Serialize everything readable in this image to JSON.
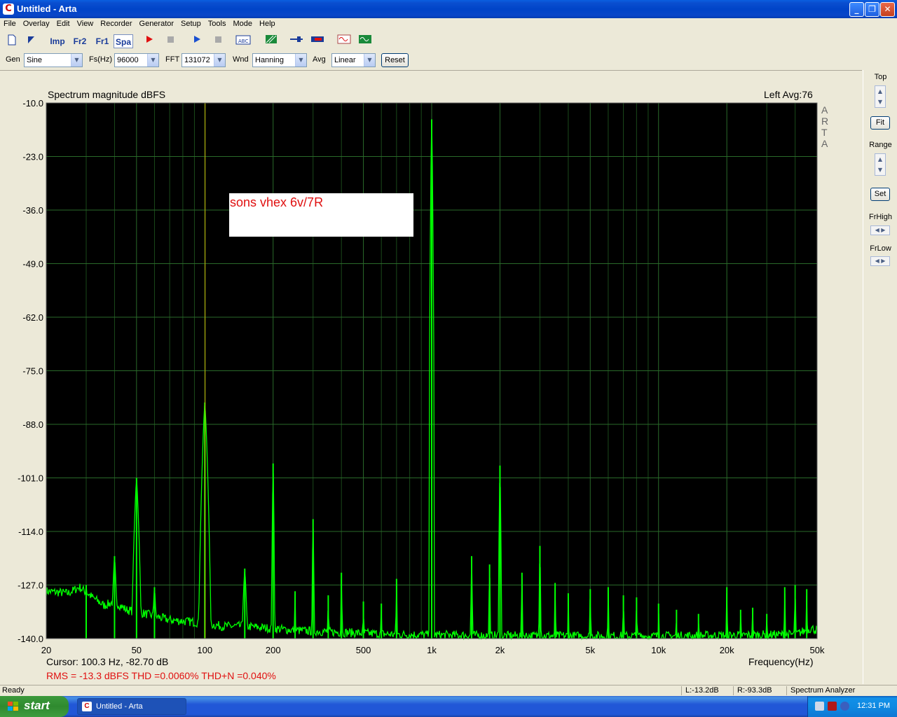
{
  "window": {
    "title": "Untitled - Arta",
    "app_icon": "C",
    "buttons": {
      "minimize": "_",
      "maximize": "❐",
      "close": "✕"
    }
  },
  "menu": [
    "File",
    "Overlay",
    "Edit",
    "View",
    "Recorder",
    "Generator",
    "Setup",
    "Tools",
    "Mode",
    "Help"
  ],
  "toolbar": {
    "imp": "Imp",
    "fr2": "Fr2",
    "fr1": "Fr1",
    "spa": "Spa"
  },
  "controls": {
    "gen_label": "Gen",
    "gen_value": "Sine",
    "fs_label": "Fs(Hz)",
    "fs_value": "96000",
    "fft_label": "FFT",
    "fft_value": "131072",
    "wnd_label": "Wnd",
    "wnd_value": "Hanning",
    "avg_label": "Avg",
    "avg_value": "Linear",
    "reset_label": "Reset"
  },
  "plot": {
    "title": "Spectrum magnitude dBFS",
    "channel": "Left  Avg:76",
    "side_label": "ARTA",
    "annotation": "sons vhex 6v/7R",
    "cursor_text": "Cursor:   100.3 Hz, -82.70 dB",
    "rms_text": "RMS =  -13.3 dBFS   THD =0.0060%   THD+N =0.040%",
    "cursor_freq_hz": 100.3
  },
  "chart_data": {
    "type": "line",
    "title": "Spectrum magnitude dBFS",
    "xlabel": "Frequency(Hz)",
    "ylabel": "",
    "x_scale": "log",
    "xlim": [
      20,
      50000
    ],
    "ylim": [
      -140,
      -10
    ],
    "y_ticks": [
      "-10.0",
      "-23.0",
      "-36.0",
      "-49.0",
      "-62.0",
      "-75.0",
      "-88.0",
      "-101.0",
      "-114.0",
      "-127.0",
      "-140.0"
    ],
    "x_ticks": [
      {
        "v": 20,
        "label": "20"
      },
      {
        "v": 50,
        "label": "50"
      },
      {
        "v": 100,
        "label": "100"
      },
      {
        "v": 200,
        "label": "200"
      },
      {
        "v": 500,
        "label": "500"
      },
      {
        "v": 1000,
        "label": "1k"
      },
      {
        "v": 2000,
        "label": "2k"
      },
      {
        "v": 5000,
        "label": "5k"
      },
      {
        "v": 10000,
        "label": "10k"
      },
      {
        "v": 20000,
        "label": "20k"
      },
      {
        "v": 50000,
        "label": "50k"
      }
    ],
    "grid": true,
    "series_color": "#00ff00",
    "noise_floor": [
      [
        20,
        -128.5
      ],
      [
        25,
        -129
      ],
      [
        28,
        -127.5
      ],
      [
        32,
        -130
      ],
      [
        36,
        -132
      ],
      [
        40,
        -131
      ],
      [
        45,
        -133
      ],
      [
        55,
        -134
      ],
      [
        70,
        -135.5
      ],
      [
        90,
        -136
      ],
      [
        120,
        -137
      ],
      [
        150,
        -137
      ],
      [
        250,
        -138
      ],
      [
        400,
        -138.5
      ],
      [
        700,
        -139
      ],
      [
        2000,
        -139.3
      ],
      [
        10000,
        -139.4
      ],
      [
        40000,
        -139
      ],
      [
        47000,
        -137.5
      ],
      [
        50000,
        -138
      ]
    ],
    "peaks": [
      {
        "f": 30,
        "db": -127.0
      },
      {
        "f": 40,
        "db": -120.0
      },
      {
        "f": 50,
        "db": -101.0
      },
      {
        "f": 60,
        "db": -127.5
      },
      {
        "f": 100,
        "db": -82.7
      },
      {
        "f": 150,
        "db": -123.0
      },
      {
        "f": 200,
        "db": -97.5
      },
      {
        "f": 250,
        "db": -128.5
      },
      {
        "f": 300,
        "db": -111.0
      },
      {
        "f": 350,
        "db": -129.5
      },
      {
        "f": 400,
        "db": -124.0
      },
      {
        "f": 500,
        "db": -131.0
      },
      {
        "f": 600,
        "db": -131.5
      },
      {
        "f": 700,
        "db": -125.5
      },
      {
        "f": 1000,
        "db": -14.0
      },
      {
        "f": 1500,
        "db": -120.0
      },
      {
        "f": 1800,
        "db": -122.0
      },
      {
        "f": 2000,
        "db": -98.0
      },
      {
        "f": 2500,
        "db": -124.0
      },
      {
        "f": 3000,
        "db": -117.5
      },
      {
        "f": 3500,
        "db": -126.5
      },
      {
        "f": 4000,
        "db": -129.0
      },
      {
        "f": 5000,
        "db": -128.0
      },
      {
        "f": 6000,
        "db": -127.5
      },
      {
        "f": 7000,
        "db": -129.5
      },
      {
        "f": 8000,
        "db": -130.0
      },
      {
        "f": 10000,
        "db": -131.5
      },
      {
        "f": 12000,
        "db": -133.0
      },
      {
        "f": 15000,
        "db": -134.0
      },
      {
        "f": 20000,
        "db": -127.5
      },
      {
        "f": 23000,
        "db": -133.0
      },
      {
        "f": 26000,
        "db": -132.5
      },
      {
        "f": 30000,
        "db": -134.0
      },
      {
        "f": 36000,
        "db": -127.5
      },
      {
        "f": 40000,
        "db": -127.0
      },
      {
        "f": 45000,
        "db": -128.0
      }
    ]
  },
  "side": {
    "top_label": "Top",
    "fit_label": "Fit",
    "range_label": "Range",
    "set_label": "Set",
    "frhigh_label": "FrHigh",
    "frlow_label": "FrLow"
  },
  "status": {
    "left": "Ready",
    "l": "L:-13.2dB",
    "r": "R:-93.3dB",
    "mode": "Spectrum Analyzer"
  },
  "taskbar": {
    "start": "start",
    "task_item": "Untitled - Arta",
    "clock": "12:31 PM"
  }
}
